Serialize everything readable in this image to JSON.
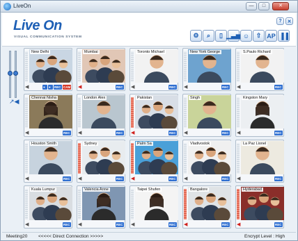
{
  "window": {
    "title": "LiveOn",
    "min_label": "—",
    "max_label": "□",
    "close_label": "✕"
  },
  "header": {
    "logo": "Live On",
    "tagline": "VISUAL COMMUNICATION SYSTEM",
    "help_label": "?",
    "close_label": "✕",
    "toolbar": [
      {
        "icon": "gear-icon",
        "glyph": "⚙"
      },
      {
        "icon": "search-icon",
        "glyph": "⌕"
      },
      {
        "icon": "bookmark-icon",
        "glyph": "▯"
      },
      {
        "icon": "bar-chart-icon",
        "glyph": "▁▃▅"
      },
      {
        "icon": "users-search-icon",
        "glyph": "☺"
      },
      {
        "icon": "share-icon",
        "glyph": "⇧"
      },
      {
        "icon": "ap-icon",
        "glyph": "AP"
      },
      {
        "icon": "signal-icon",
        "glyph": "▐▐"
      }
    ]
  },
  "tiles": [
    {
      "name": "New Delhi",
      "scene": "group",
      "bg": "#c9d6e3",
      "speaker_red": false,
      "badges": [
        "rec-mute",
        "rec-user",
        "REC",
        "CAM"
      ],
      "level_on": false
    },
    {
      "name": "Mumbai",
      "scene": "group",
      "bg": "#e1c7b6",
      "speaker_red": true,
      "badges": [
        "REC"
      ],
      "level_on": false
    },
    {
      "name": "Toronto Michael",
      "scene": "man",
      "bg": "#f2f2f2",
      "speaker_red": false,
      "badges": [
        "REC"
      ],
      "level_on": false
    },
    {
      "name": "New York George",
      "scene": "man",
      "bg": "#6ea3cf",
      "speaker_red": false,
      "badges": [
        "REC"
      ],
      "level_on": false
    },
    {
      "name": "S.Paulo Richard",
      "scene": "man",
      "bg": "#f2f2f2",
      "speaker_red": false,
      "badges": [
        "REC"
      ],
      "level_on": false
    },
    {
      "name": "Chennai Nisha",
      "scene": "woman",
      "bg": "#8b7a5a",
      "speaker_red": false,
      "badges": [
        "REC"
      ],
      "level_on": false
    },
    {
      "name": "London Alex",
      "scene": "man",
      "bg": "#b9c6cf",
      "speaker_red": false,
      "badges": [
        "REC"
      ],
      "level_on": false
    },
    {
      "name": "Pakistan",
      "scene": "group",
      "bg": "#d8dee6",
      "speaker_red": true,
      "badges": [
        "REC"
      ],
      "level_on": true
    },
    {
      "name": "Singh",
      "scene": "man",
      "bg": "#c9d49a",
      "speaker_red": false,
      "badges": [
        "REC"
      ],
      "level_on": false
    },
    {
      "name": "Kingston Mary",
      "scene": "woman",
      "bg": "#eceff2",
      "speaker_red": false,
      "badges": [
        "REC"
      ],
      "level_on": false
    },
    {
      "name": "Houston Smith",
      "scene": "man",
      "bg": "#c7d3de",
      "speaker_red": false,
      "badges": [
        "REC"
      ],
      "level_on": false
    },
    {
      "name": "Sydney",
      "scene": "group",
      "bg": "#e8ecef",
      "speaker_red": false,
      "badges": [
        "REC"
      ],
      "level_on": true
    },
    {
      "name": "Palm Sa",
      "scene": "group",
      "bg": "#4aa0d8",
      "speaker_red": true,
      "badges": [
        "REC"
      ],
      "level_on": true
    },
    {
      "name": "Vladivostok",
      "scene": "group",
      "bg": "#f0f0f0",
      "speaker_red": false,
      "badges": [
        "REC"
      ],
      "level_on": false
    },
    {
      "name": "La Paz Lionel",
      "scene": "man",
      "bg": "#edeae0",
      "speaker_red": false,
      "badges": [
        "REC"
      ],
      "level_on": false
    },
    {
      "name": "Kuala Lumpur",
      "scene": "group",
      "bg": "#d9dde1",
      "speaker_red": false,
      "badges": [
        "REC"
      ],
      "level_on": false
    },
    {
      "name": "Valencia Anne",
      "scene": "woman",
      "bg": "#7f96b2",
      "speaker_red": false,
      "badges": [
        "REC"
      ],
      "level_on": false
    },
    {
      "name": "Taipei Shufen",
      "scene": "woman",
      "bg": "#f4f4f4",
      "speaker_red": false,
      "badges": [
        "REC"
      ],
      "level_on": false
    },
    {
      "name": "Bangalore",
      "scene": "group",
      "bg": "#dfe3e6",
      "speaker_red": true,
      "badges": [
        "REC"
      ],
      "level_on": true
    },
    {
      "name": "Hyderabad",
      "scene": "group",
      "bg": "#8a2e2a",
      "speaker_red": true,
      "badges": [
        "REC"
      ],
      "level_on": true
    }
  ],
  "status": {
    "meeting": "Meeting20",
    "connection": "<<<<< Direct Connection >>>>>",
    "encrypt": "Encrypt Level : High"
  }
}
